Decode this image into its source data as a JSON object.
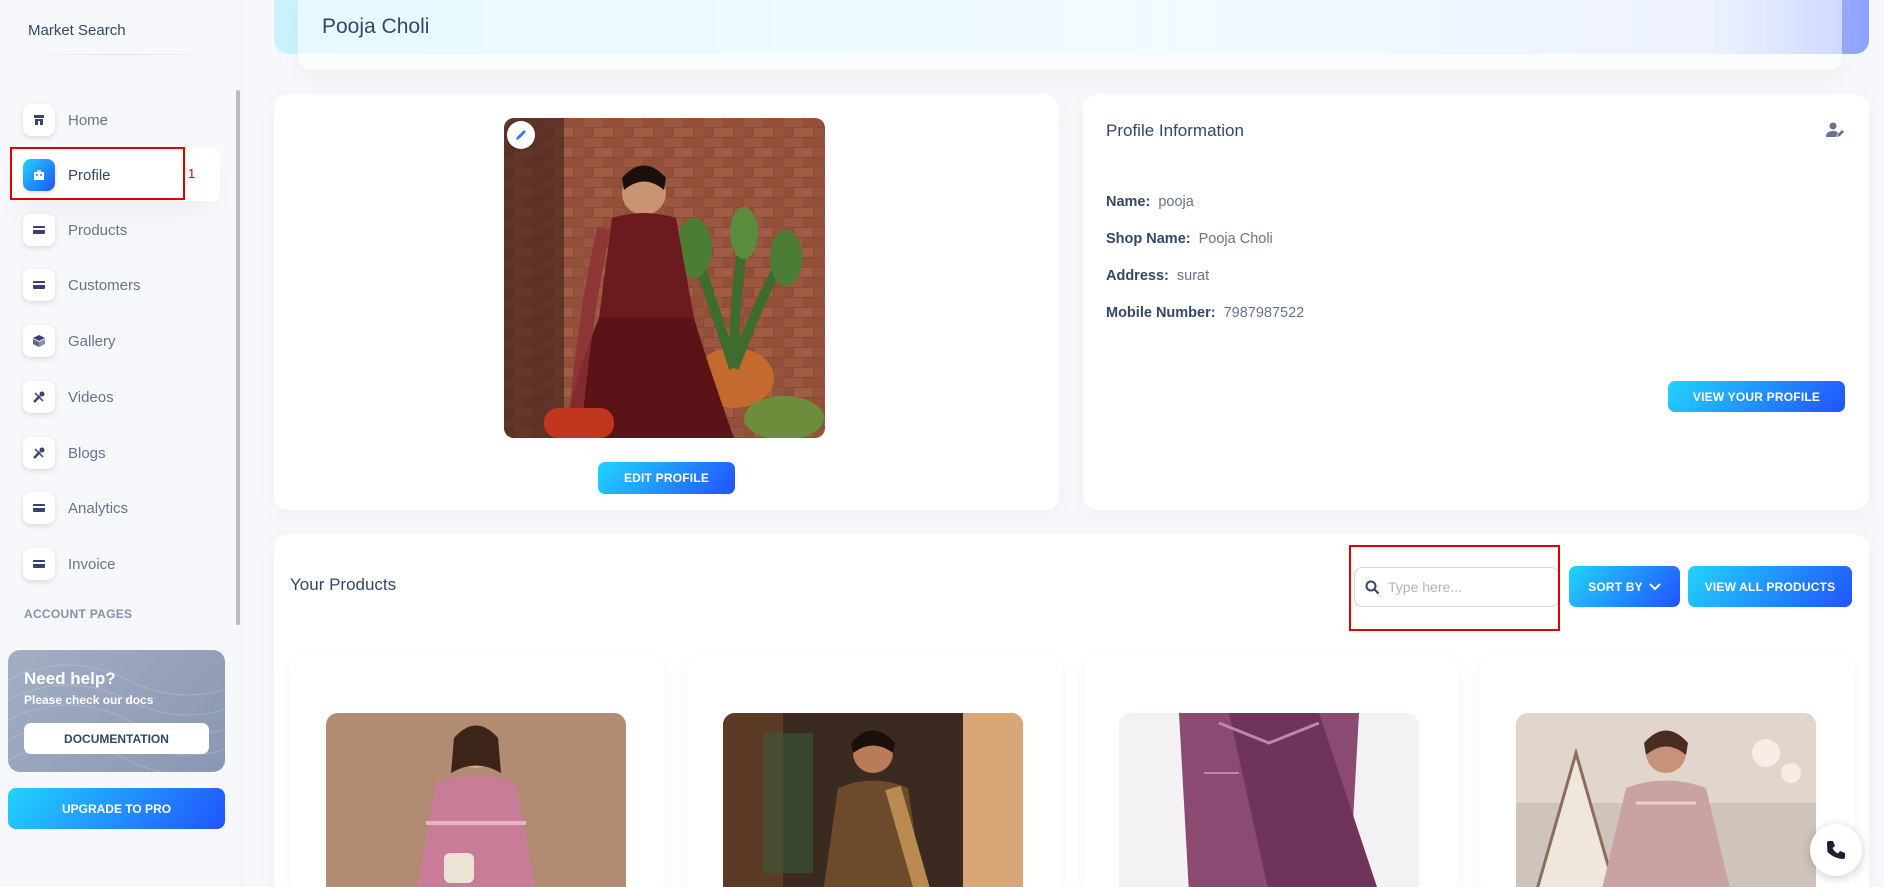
{
  "sidebar": {
    "brand": "Market Search",
    "items": [
      {
        "label": "Home",
        "icon": "shop-icon"
      },
      {
        "label": "Profile",
        "icon": "office-icon"
      },
      {
        "label": "Products",
        "icon": "credit-card-icon"
      },
      {
        "label": "Customers",
        "icon": "credit-card-icon"
      },
      {
        "label": "Gallery",
        "icon": "box-3d-icon"
      },
      {
        "label": "Videos",
        "icon": "settings-icon"
      },
      {
        "label": "Blogs",
        "icon": "settings-icon"
      },
      {
        "label": "Analytics",
        "icon": "credit-card-icon"
      },
      {
        "label": "Invoice",
        "icon": "credit-card-icon"
      }
    ],
    "active_item": "Profile",
    "section_title": "ACCOUNT PAGES",
    "annotation_number": "1",
    "help": {
      "title": "Need help?",
      "subtitle": "Please check our docs",
      "button": "DOCUMENTATION"
    },
    "upgrade_button": "UPGRADE TO PRO"
  },
  "header": {
    "title": "Pooja Choli"
  },
  "profile_card": {
    "edit_button": "EDIT PROFILE"
  },
  "profile_info": {
    "heading": "Profile Information",
    "fields": [
      {
        "key": "Name:",
        "value": "pooja"
      },
      {
        "key": "Shop Name:",
        "value": "Pooja Choli"
      },
      {
        "key": "Address:",
        "value": "surat"
      },
      {
        "key": "Mobile Number:",
        "value": "7987987522"
      }
    ],
    "view_button": "VIEW YOUR PROFILE"
  },
  "products": {
    "heading": "Your Products",
    "search_placeholder": "Type here...",
    "sort_button": "SORT BY",
    "view_all_button": "VIEW ALL PRODUCTS"
  },
  "colors": {
    "accent_gradient_start": "#2152ff",
    "accent_gradient_end": "#21d4fd",
    "annotation_red": "#e00000"
  }
}
